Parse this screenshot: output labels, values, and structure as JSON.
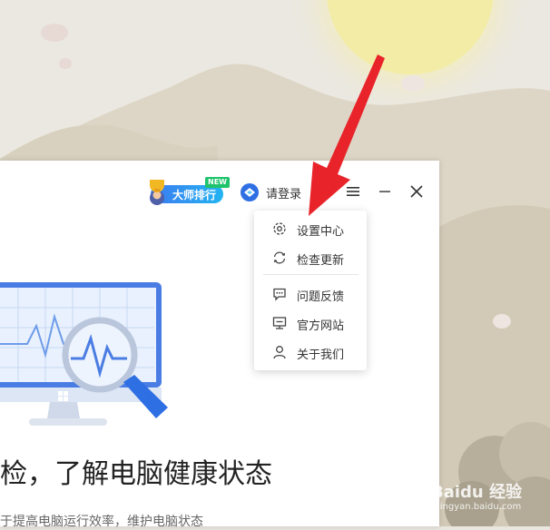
{
  "app": {
    "badge": {
      "label": "大师排行",
      "new_tag": "NEW"
    },
    "login_label": "请登录",
    "headline": "检，了解电脑健康状态",
    "subtitle": "于提高电脑运行效率，维护电脑状态"
  },
  "menu": {
    "items": [
      {
        "label": "设置中心",
        "icon": "gear-icon"
      },
      {
        "label": "检查更新",
        "icon": "refresh-icon"
      },
      {
        "label": "问题反馈",
        "icon": "feedback-icon"
      },
      {
        "label": "官方网站",
        "icon": "monitor-icon"
      },
      {
        "label": "关于我们",
        "icon": "user-icon"
      }
    ]
  },
  "watermark": {
    "brand": "Baidu 经验",
    "url": "jingyan.baidu.com"
  },
  "colors": {
    "accent": "#3c7bf0",
    "arrow": "#e8242a",
    "new_badge": "#1ec36b"
  }
}
